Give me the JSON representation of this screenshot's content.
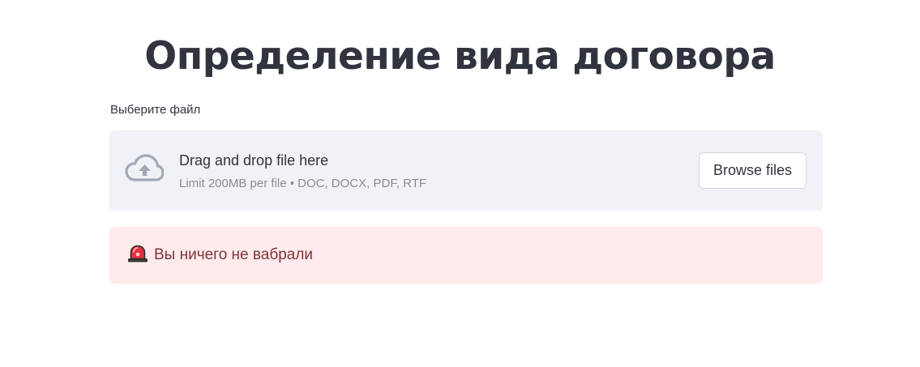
{
  "page": {
    "title": "Определение вида договора"
  },
  "uploader": {
    "label": "Выберите файл",
    "dropzone_text": "Drag and drop file here",
    "limit_text": "Limit 200MB per file • DOC, DOCX, PDF, RTF",
    "browse_label": "Browse files",
    "icon": "cloud-upload-icon"
  },
  "alert": {
    "type": "error",
    "icon": "rotating-light-icon",
    "message": "Вы ничего не вабрали"
  },
  "colors": {
    "text": "#31333f",
    "dropzone_bg": "#f0f2f6",
    "muted_text": "#8b8d95",
    "error_bg": "#ffebec",
    "error_text": "#7d353b",
    "icon_gray": "#a3a8b8"
  }
}
